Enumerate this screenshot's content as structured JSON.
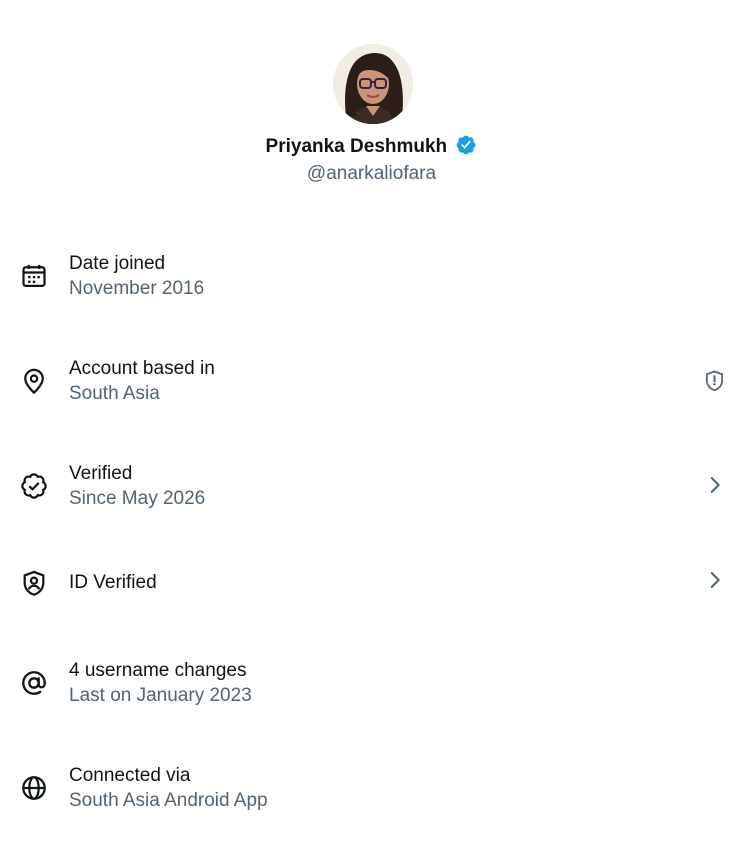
{
  "profile": {
    "name": "Priyanka Deshmukh",
    "handle": "@anarkaliofara",
    "verified": true,
    "badge_color": "#1d9bf0"
  },
  "rows": [
    {
      "icon": "calendar-icon",
      "title": "Date joined",
      "subtitle": "November 2016",
      "trailing": null
    },
    {
      "icon": "location-pin-icon",
      "title": "Account based in",
      "subtitle": "South Asia",
      "trailing": "shield-alert-icon"
    },
    {
      "icon": "verified-check-icon",
      "title": "Verified",
      "subtitle": "Since May 2026",
      "trailing": "chevron-right-icon"
    },
    {
      "icon": "id-shield-icon",
      "title": "ID Verified",
      "subtitle": null,
      "trailing": "chevron-right-icon"
    },
    {
      "icon": "at-sign-icon",
      "title": "4 username changes",
      "subtitle": "Last on January 2023",
      "trailing": null
    },
    {
      "icon": "globe-icon",
      "title": "Connected via",
      "subtitle": "South Asia Android App",
      "trailing": null
    }
  ],
  "colors": {
    "text_primary": "#0f1419",
    "text_secondary": "#536471",
    "icon": "#0f1419",
    "trailing_icon": "#536471"
  }
}
